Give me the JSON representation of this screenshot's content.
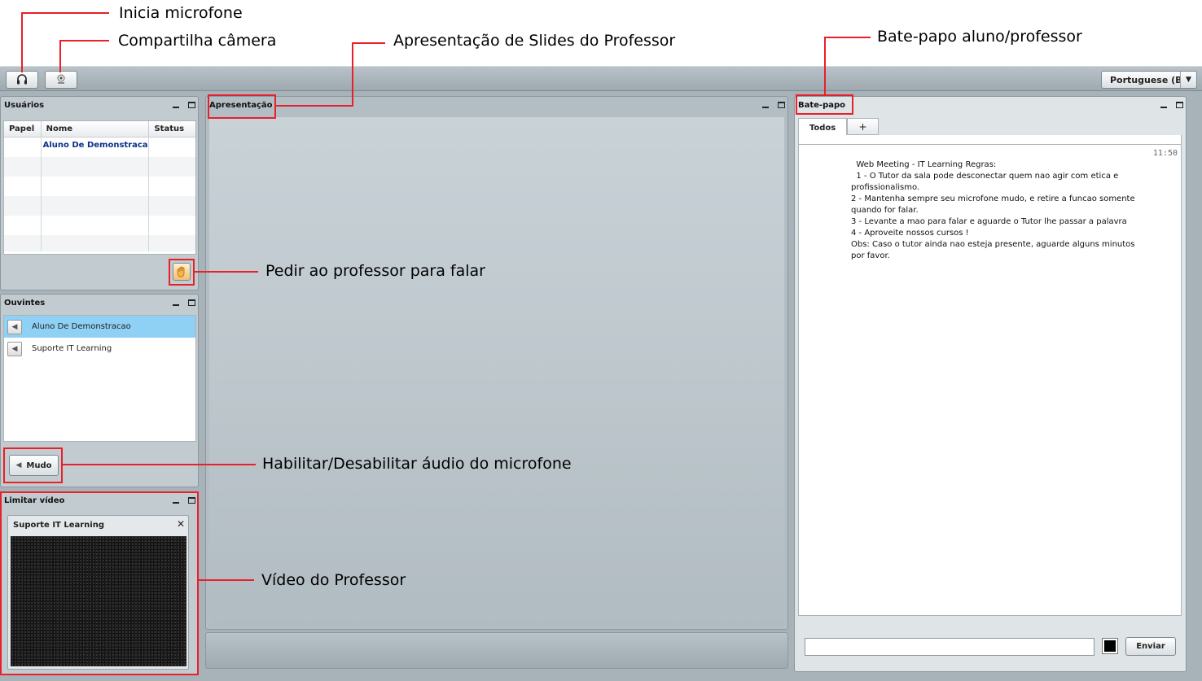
{
  "annotations": {
    "mic": "Inicia microfone",
    "camera": "Compartilha câmera",
    "slides": "Apresentação de Slides do Professor",
    "chat": "Bate-papo aluno/professor",
    "raise_hand": "Pedir ao professor para falar",
    "mute": "Habilitar/Desabilitar áudio do microfone",
    "video": "Vídeo do Professor"
  },
  "toolbar": {
    "language": "Portuguese (B"
  },
  "users_panel": {
    "title": "Usuários",
    "columns": [
      "Papel",
      "Nome",
      "Status"
    ],
    "rows": [
      {
        "papel": "",
        "nome": "Aluno De Demonstraca",
        "status": ""
      }
    ]
  },
  "listeners_panel": {
    "title": "Ouvintes",
    "items": [
      {
        "name": "Aluno De Demonstracao",
        "selected": true
      },
      {
        "name": "Suporte IT Learning",
        "selected": false
      }
    ],
    "mute_label": "Mudo"
  },
  "video_panel": {
    "title": "Limitar vídeo",
    "window_title": "Suporte IT Learning",
    "close_glyph": "✕"
  },
  "presentation_panel": {
    "title": "Apresentação"
  },
  "chat_panel": {
    "title": "Bate-papo",
    "tabs": [
      {
        "label": "Todos",
        "active": true
      },
      {
        "label": "+",
        "active": false
      }
    ],
    "time": "11:50",
    "message": "  Web Meeting - IT Learning Regras:\n  1 - O Tutor da sala pode desconectar quem nao agir com etica e profissionalismo.\n2 - Mantenha sempre seu microfone mudo, e retire a funcao somente quando for falar.\n3 - Levante a mao para falar e aguarde o Tutor lhe passar a palavra\n4 - Aproveite nossos cursos !\nObs: Caso o tutor ainda nao esteja presente, aguarde alguns minutos por favor.",
    "input_value": "",
    "send_label": "Enviar",
    "color_swatch": "#000000"
  },
  "colors": {
    "annotation_red": "#e8202a",
    "selected_row": "#8fd0f5",
    "app_background": "#a7b2b9"
  }
}
